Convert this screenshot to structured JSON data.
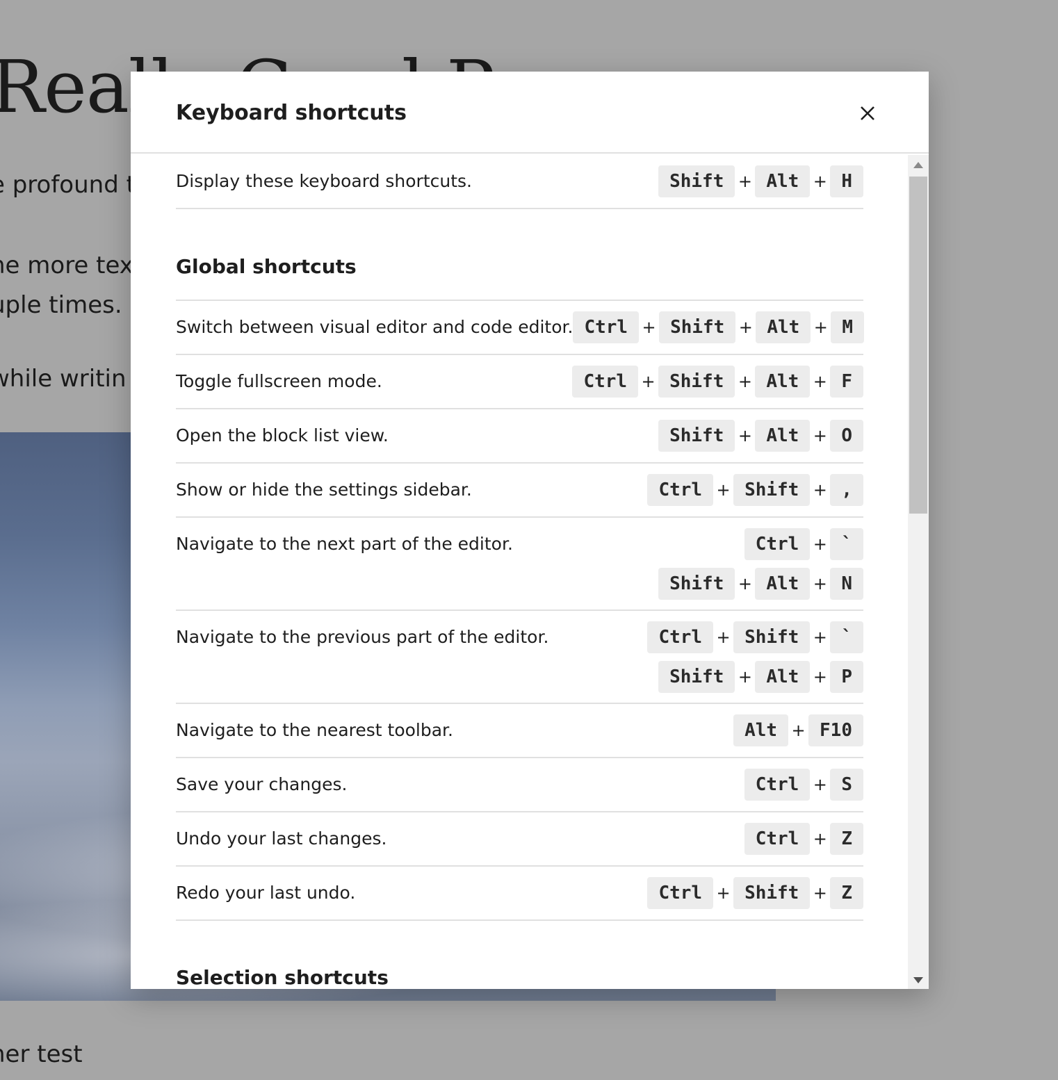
{
  "background": {
    "post_title": "Really Good P",
    "paragraphs": [
      "e profound t",
      "he more text",
      "uple times.",
      " while writin"
    ],
    "footer_text": "her test"
  },
  "modal": {
    "title": "Keyboard shortcuts",
    "close_icon": "close-icon",
    "top_row": {
      "description": "Display these keyboard shortcuts.",
      "combos": [
        [
          "Shift",
          "Alt",
          "H"
        ]
      ]
    },
    "sections": [
      {
        "title": "Global shortcuts",
        "rows": [
          {
            "description": "Switch between visual editor and code editor.",
            "combos": [
              [
                "Ctrl",
                "Shift",
                "Alt",
                "M"
              ]
            ]
          },
          {
            "description": "Toggle fullscreen mode.",
            "combos": [
              [
                "Ctrl",
                "Shift",
                "Alt",
                "F"
              ]
            ]
          },
          {
            "description": "Open the block list view.",
            "combos": [
              [
                "Shift",
                "Alt",
                "O"
              ]
            ]
          },
          {
            "description": "Show or hide the settings sidebar.",
            "combos": [
              [
                "Ctrl",
                "Shift",
                ","
              ]
            ]
          },
          {
            "description": "Navigate to the next part of the editor.",
            "combos": [
              [
                "Ctrl",
                "`"
              ],
              [
                "Shift",
                "Alt",
                "N"
              ]
            ]
          },
          {
            "description": "Navigate to the previous part of the editor.",
            "combos": [
              [
                "Ctrl",
                "Shift",
                "`"
              ],
              [
                "Shift",
                "Alt",
                "P"
              ]
            ]
          },
          {
            "description": "Navigate to the nearest toolbar.",
            "combos": [
              [
                "Alt",
                "F10"
              ]
            ]
          },
          {
            "description": "Save your changes.",
            "combos": [
              [
                "Ctrl",
                "S"
              ]
            ]
          },
          {
            "description": "Undo your last changes.",
            "combos": [
              [
                "Ctrl",
                "Z"
              ]
            ]
          },
          {
            "description": "Redo your last undo.",
            "combos": [
              [
                "Ctrl",
                "Shift",
                "Z"
              ]
            ]
          }
        ]
      },
      {
        "title": "Selection shortcuts",
        "rows": []
      }
    ],
    "plus_symbol": "+"
  },
  "scrollbar": {
    "position_fraction": 0.0
  }
}
